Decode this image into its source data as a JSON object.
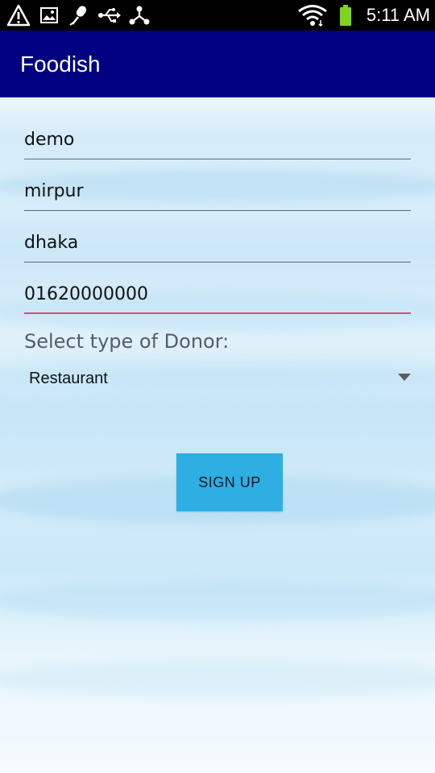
{
  "status_bar": {
    "time": "5:11 AM",
    "icons": [
      "warning-icon",
      "image-icon",
      "microphone-icon",
      "usb-icon",
      "share-icon",
      "wifi-icon",
      "battery-icon"
    ],
    "battery_color": "#7ed321"
  },
  "app_bar": {
    "title": "Foodish",
    "color": "#000080"
  },
  "form": {
    "name_value": "demo",
    "area_value": "mirpur",
    "city_value": "dhaka",
    "phone_value": "01620000000",
    "donor_type_label": "Select type of Donor:",
    "donor_type_selected": "Restaurant",
    "signup_label": "SIGN UP"
  },
  "colors": {
    "accent": "#e0487a",
    "button": "#2eaee2"
  }
}
